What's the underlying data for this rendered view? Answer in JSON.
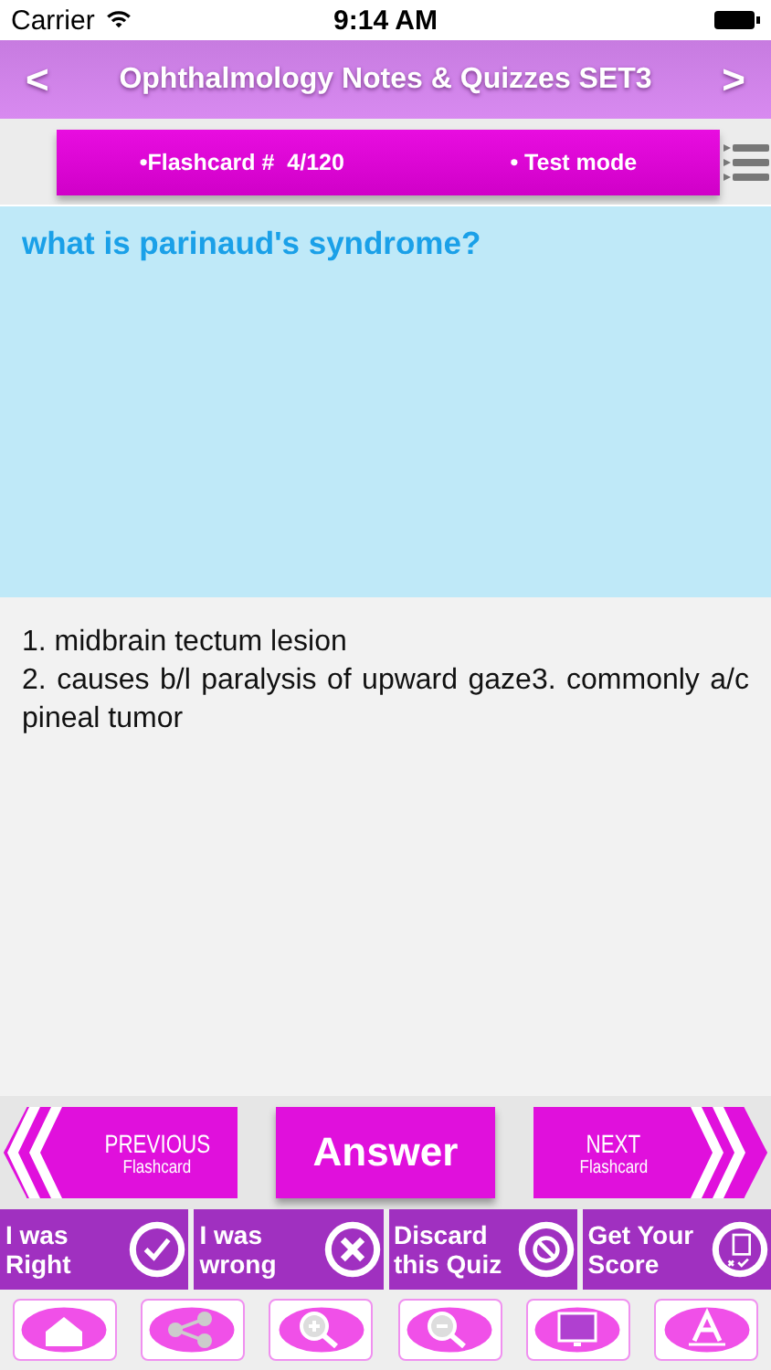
{
  "status_bar": {
    "carrier": "Carrier",
    "time": "9:14 AM"
  },
  "nav": {
    "back": "<",
    "title": "Ophthalmology Notes & Quizzes SET3",
    "forward": ">"
  },
  "card_bar": {
    "counter": "•Flashcard #  4/120",
    "mode": "• Test mode"
  },
  "question": "what is parinaud's syndrome?",
  "answer_lines": [
    "1. midbrain tectum lesion",
    "2. causes b/l paralysis of upward gaze3. commonly a/c pineal tumor"
  ],
  "nav_buttons": [
    {
      "kind": "previous",
      "label": "PREVIOUS",
      "sub": "Flashcard"
    },
    {
      "kind": "answer",
      "label": "Answer"
    },
    {
      "kind": "next",
      "label": "NEXT",
      "sub": "Flashcard"
    }
  ],
  "actions": [
    {
      "kind": "check",
      "label": "I was Right"
    },
    {
      "kind": "cross",
      "label": "I was wrong"
    },
    {
      "kind": "ban",
      "label": "Discard this Quiz"
    },
    {
      "kind": "score",
      "label": "Get Your Score"
    }
  ],
  "toolbar": [
    {
      "kind": "home"
    },
    {
      "kind": "share"
    },
    {
      "kind": "zoom-in"
    },
    {
      "kind": "zoom-out"
    },
    {
      "kind": "screen"
    },
    {
      "kind": "font"
    }
  ]
}
